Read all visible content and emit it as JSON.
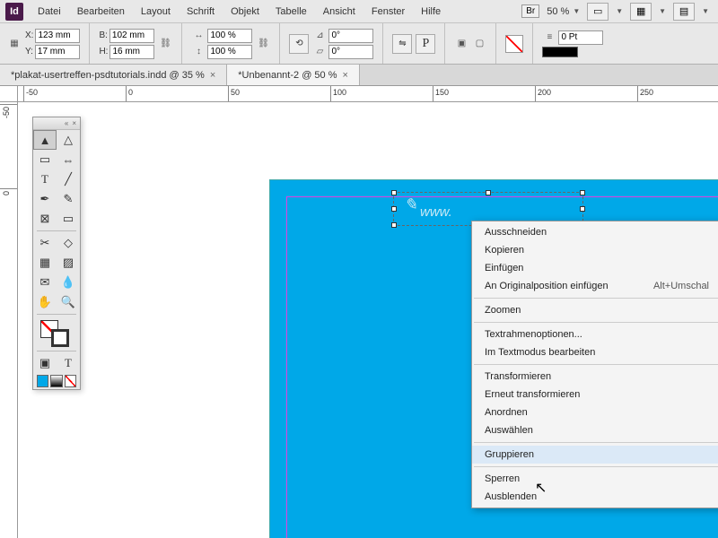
{
  "app": {
    "icon_label": "Id"
  },
  "menu": {
    "items": [
      "Datei",
      "Bearbeiten",
      "Layout",
      "Schrift",
      "Objekt",
      "Tabelle",
      "Ansicht",
      "Fenster",
      "Hilfe"
    ],
    "bridge_label": "Br",
    "zoom": "50 %"
  },
  "control": {
    "x_label": "X:",
    "x_value": "123 mm",
    "y_label": "Y:",
    "y_value": "17 mm",
    "w_label": "B:",
    "w_value": "102 mm",
    "h_label": "H:",
    "h_value": "16 mm",
    "scale_x": "100 %",
    "scale_y": "100 %",
    "rotate": "0°",
    "shear": "0°",
    "stroke_pt": "0 Pt"
  },
  "tabs": [
    {
      "label": "*plakat-usertreffen-psdtutorials.indd @ 35 %",
      "active": false
    },
    {
      "label": "*Unbenannt-2 @ 50 %",
      "active": true
    }
  ],
  "ruler_h": [
    "-50",
    "0",
    "50",
    "100",
    "150",
    "200",
    "250"
  ],
  "ruler_v": [
    "-50",
    "0"
  ],
  "canvas": {
    "visible_text": "www."
  },
  "context_menu": {
    "groups": [
      [
        {
          "label": "Ausschneiden"
        },
        {
          "label": "Kopieren"
        },
        {
          "label": "Einfügen"
        },
        {
          "label": "An Originalposition einfügen",
          "shortcut": "Alt+Umschal"
        }
      ],
      [
        {
          "label": "Zoomen"
        }
      ],
      [
        {
          "label": "Textrahmenoptionen..."
        },
        {
          "label": "Im Textmodus bearbeiten"
        }
      ],
      [
        {
          "label": "Transformieren"
        },
        {
          "label": "Erneut transformieren"
        },
        {
          "label": "Anordnen"
        },
        {
          "label": "Auswählen"
        }
      ],
      [
        {
          "label": "Gruppieren",
          "highlight": true
        }
      ],
      [
        {
          "label": "Sperren"
        },
        {
          "label": "Ausblenden"
        }
      ]
    ]
  },
  "tools": {
    "names": [
      "selection-tool",
      "direct-selection-tool",
      "page-tool",
      "gap-tool",
      "type-tool",
      "line-tool",
      "pen-tool",
      "pencil-tool",
      "rectangle-frame-tool",
      "rectangle-tool",
      "scissors-tool",
      "free-transform-tool",
      "gradient-swatch-tool",
      "gradient-feather-tool",
      "note-tool",
      "eyedropper-tool",
      "hand-tool",
      "zoom-tool"
    ],
    "bottom_modes": [
      "normal-mode-icon",
      "preview-mode-icon"
    ]
  }
}
